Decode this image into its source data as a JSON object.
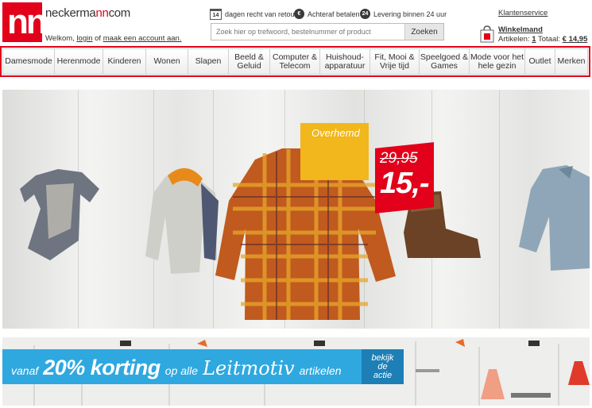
{
  "header": {
    "logo_text": "nn",
    "brand_prefix": "neckerma",
    "brand_highlight": "nn",
    "brand_suffix": "com",
    "welcome_prefix": "Welkom,",
    "login_link": "login",
    "welcome_or": "of",
    "register_link": "maak een account aan.",
    "usps": [
      {
        "icon": "calendar-14-icon",
        "icon_text": "14",
        "text": "dagen recht van retour"
      },
      {
        "icon": "euro-icon",
        "icon_text": "€",
        "text": "Achteraf betalen"
      },
      {
        "icon": "delivery-24-icon",
        "icon_text": "24",
        "text": "Levering binnen 24 uur"
      }
    ],
    "search_placeholder": "Zoek hier op trefwoord, bestelnummer of product",
    "search_button": "Zoeken",
    "customer_service": "Klantenservice",
    "cart": {
      "title": "Winkelmand",
      "articles_label": "Artikelen:",
      "articles_count": "1",
      "total_label": "Totaal:",
      "total_value": "€ 14,95"
    }
  },
  "nav": {
    "items": [
      "Damesmode",
      "Herenmode",
      "Kinderen",
      "Wonen",
      "Slapen",
      "Beeld &\nGeluid",
      "Computer &\nTelecom",
      "Huishoud-\napparatuur",
      "Fit, Mooi &\nVrije tijd",
      "Speelgoed &\nGames",
      "Mode voor het\nhele gezin",
      "Outlet",
      "Merken"
    ]
  },
  "hero": {
    "tag": "Overhemd",
    "old_price": "29,95",
    "new_price": "15,-"
  },
  "banner": {
    "prefix": "vanaf",
    "discount": "20% korting",
    "middle": "op alle",
    "brand": "Leitmotiv",
    "suffix": "artikelen",
    "cta": "bekijk\nde\nactie"
  },
  "colors": {
    "brand_red": "#e2001a",
    "banner_blue": "#2fa8df",
    "cta_blue": "#1d7fb6",
    "tag_yellow": "#f1b71c"
  }
}
